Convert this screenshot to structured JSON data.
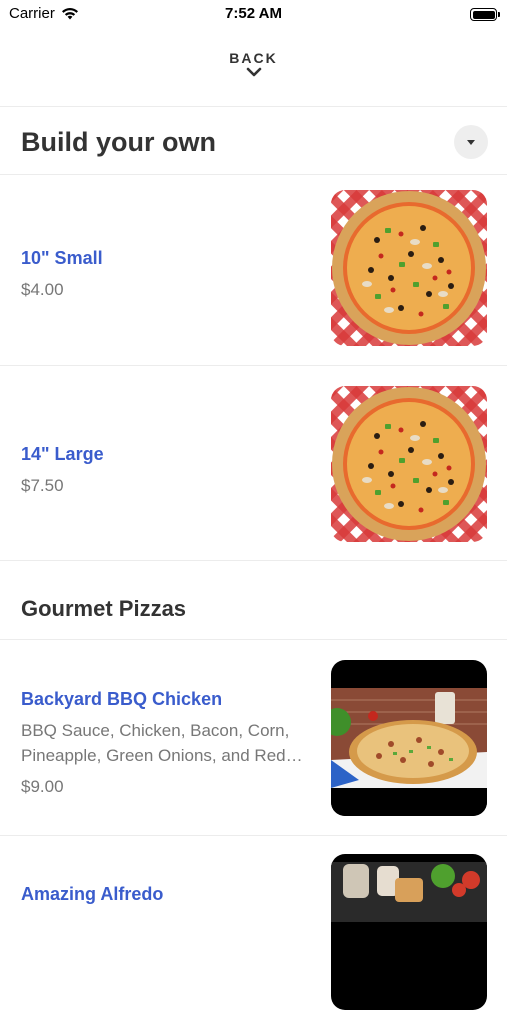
{
  "status_bar": {
    "carrier": "Carrier",
    "time": "7:52 AM"
  },
  "header": {
    "back_label": "BACK"
  },
  "sections": [
    {
      "title": "Build your own",
      "items": [
        {
          "name": "10\" Small",
          "price": "$4.00"
        },
        {
          "name": "14\" Large",
          "price": "$7.50"
        }
      ]
    },
    {
      "title": "Gourmet Pizzas",
      "items": [
        {
          "name": "Backyard BBQ Chicken",
          "description_line1": "BBQ Sauce, Chicken, Bacon, Corn,",
          "description_line2": "Pineapple, Green Onions, and Red…",
          "price": "$9.00"
        },
        {
          "name": "Amazing Alfredo"
        }
      ]
    }
  ],
  "icons": {
    "wifi": "wifi-icon",
    "battery": "battery-icon",
    "back_chevron": "chevron-down-icon",
    "collapse": "caret-down-icon"
  },
  "colors": {
    "item_name": "#3a5ccc",
    "price": "#777777",
    "title": "#333333"
  }
}
